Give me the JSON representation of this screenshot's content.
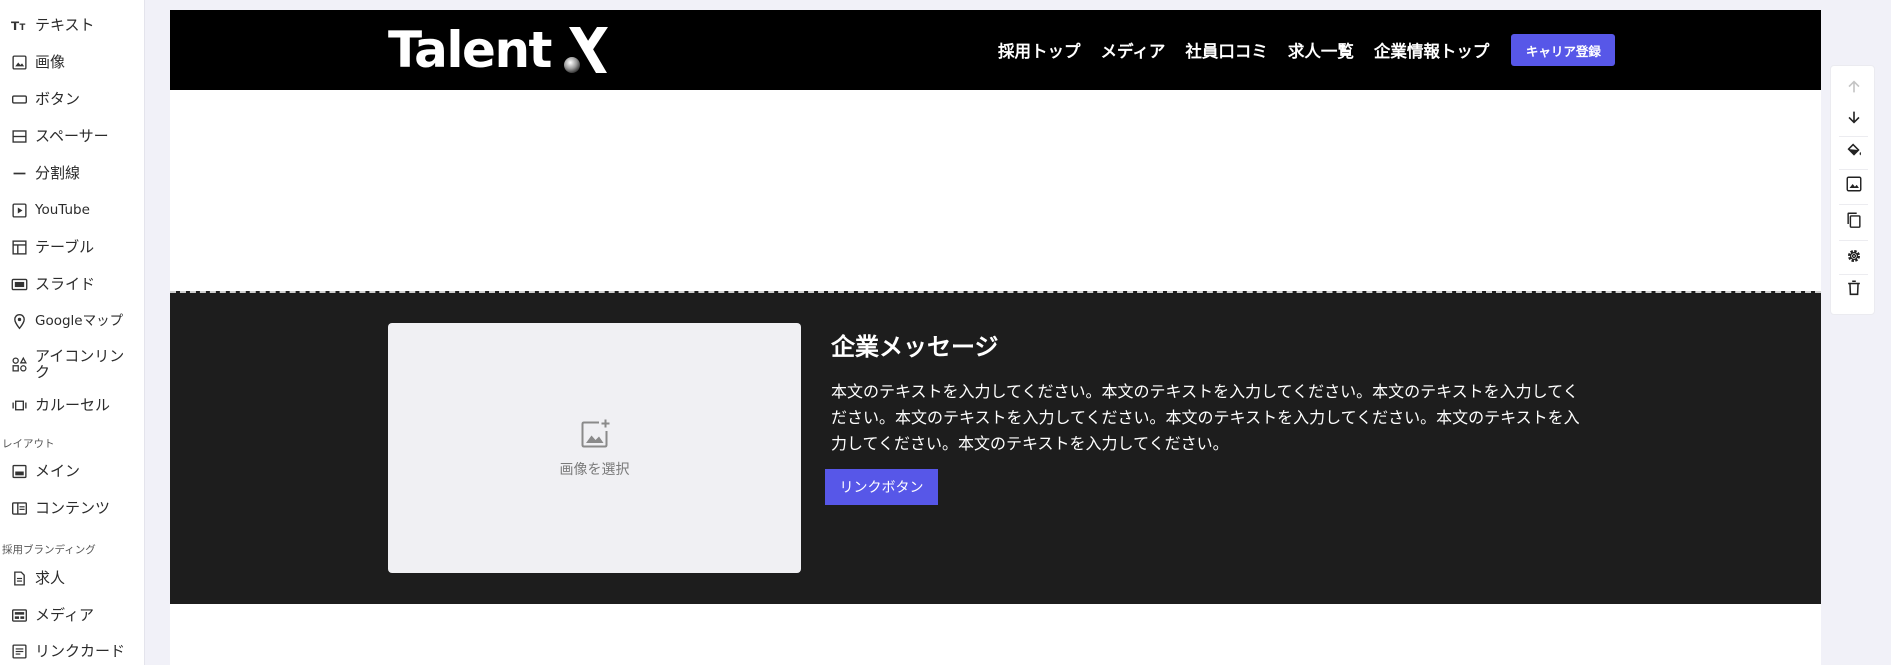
{
  "sidebar": {
    "items": [
      {
        "label": "テキスト",
        "icon": "text-icon"
      },
      {
        "label": "画像",
        "icon": "image-icon"
      },
      {
        "label": "ボタン",
        "icon": "button-icon"
      },
      {
        "label": "スペーサー",
        "icon": "spacer-icon"
      },
      {
        "label": "分割線",
        "icon": "divider-icon"
      },
      {
        "label": "YouTube",
        "icon": "youtube-icon"
      },
      {
        "label": "テーブル",
        "icon": "table-icon"
      },
      {
        "label": "スライド",
        "icon": "slide-icon"
      },
      {
        "label": "Googleマップ",
        "icon": "map-pin-icon"
      },
      {
        "label": "アイコンリンク",
        "icon": "icon-link-icon"
      },
      {
        "label": "カルーセル",
        "icon": "carousel-icon"
      }
    ],
    "layout_section": "レイアウト",
    "layout_items": [
      {
        "label": "メイン",
        "icon": "main-layout-icon"
      },
      {
        "label": "コンテンツ",
        "icon": "content-layout-icon"
      }
    ],
    "branding_section": "採用ブランディング",
    "branding_items": [
      {
        "label": "求人",
        "icon": "job-icon"
      },
      {
        "label": "メディア",
        "icon": "media-icon"
      },
      {
        "label": "リンクカード",
        "icon": "link-card-icon"
      }
    ]
  },
  "header": {
    "logo": "Talent",
    "nav": [
      "採用トップ",
      "メディア",
      "社員口コミ",
      "求人一覧",
      "企業情報トップ"
    ],
    "cta": "キャリア登録"
  },
  "section": {
    "image_placeholder": "画像を選択",
    "title": "企業メッセージ",
    "body": "本文のテキストを入力してください。本文のテキストを入力してください。本文のテキストを入力してください。本文のテキストを入力してください。本文のテキストを入力してください。本文のテキストを入力してください。本文のテキストを入力してください。",
    "button": "リンクボタン"
  },
  "toolbar": {
    "buttons": [
      "arrow-up-icon",
      "arrow-down-icon",
      "paint-bucket-icon",
      "background-image-icon",
      "duplicate-icon",
      "settings-gear-icon",
      "delete-trash-icon"
    ]
  },
  "colors": {
    "accent": "#5757e8",
    "header_bg": "#000000",
    "section_bg": "#1d1d1d",
    "page_bg": "#f1f1f8"
  }
}
